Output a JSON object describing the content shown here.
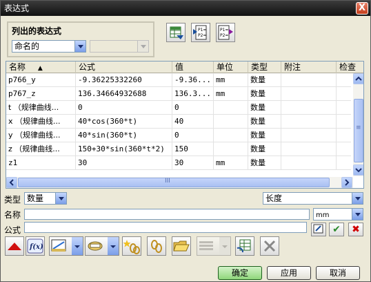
{
  "window": {
    "title": "表达式",
    "close_glyph": "X"
  },
  "list_group": {
    "title": "列出的表达式",
    "filter_value": "命名的",
    "second_value": ""
  },
  "table": {
    "columns": [
      "名称",
      "公式",
      "值",
      "单位",
      "类型",
      "附注",
      "检查"
    ],
    "sort_indicator": "▲",
    "rows": [
      {
        "name": "p766_y",
        "formula": "-9.36225332260",
        "value": "-9.36...",
        "unit": "mm",
        "type": "数量",
        "note": ""
      },
      {
        "name": "p767_z",
        "formula": "136.34664932688",
        "value": "136.3...",
        "unit": "mm",
        "type": "数量",
        "note": ""
      },
      {
        "name": "t （规律曲线...",
        "formula": "0",
        "value": "0",
        "unit": "",
        "type": "数量",
        "note": ""
      },
      {
        "name": "x （规律曲线...",
        "formula": "40*cos(360*t)",
        "value": "40",
        "unit": "",
        "type": "数量",
        "note": ""
      },
      {
        "name": "y （规律曲线...",
        "formula": "40*sin(360*t)",
        "value": "0",
        "unit": "",
        "type": "数量",
        "note": ""
      },
      {
        "name": "z （规律曲线...",
        "formula": "150+30*sin(360*t*2)",
        "value": "150",
        "unit": "",
        "type": "数量",
        "note": ""
      },
      {
        "name": "z1",
        "formula": "30",
        "value": "30",
        "unit": "mm",
        "type": "数量",
        "note": ""
      }
    ],
    "hscroll_grip": "III",
    "vscroll_grip": "≡"
  },
  "form": {
    "type_label": "类型",
    "type_value": "数量",
    "dimension_value": "长度",
    "name_label": "名称",
    "name_value": "",
    "unit_value": "mm",
    "formula_label": "公式",
    "formula_value": ""
  },
  "buttons": {
    "ok": "确定",
    "apply": "应用",
    "cancel": "取消"
  },
  "icons": {
    "export": "spreadsheet-export-icon",
    "p1p2_a": "P1=\nP2=",
    "p1p2_b": "P1=\nP2=",
    "function": "f(x)"
  }
}
